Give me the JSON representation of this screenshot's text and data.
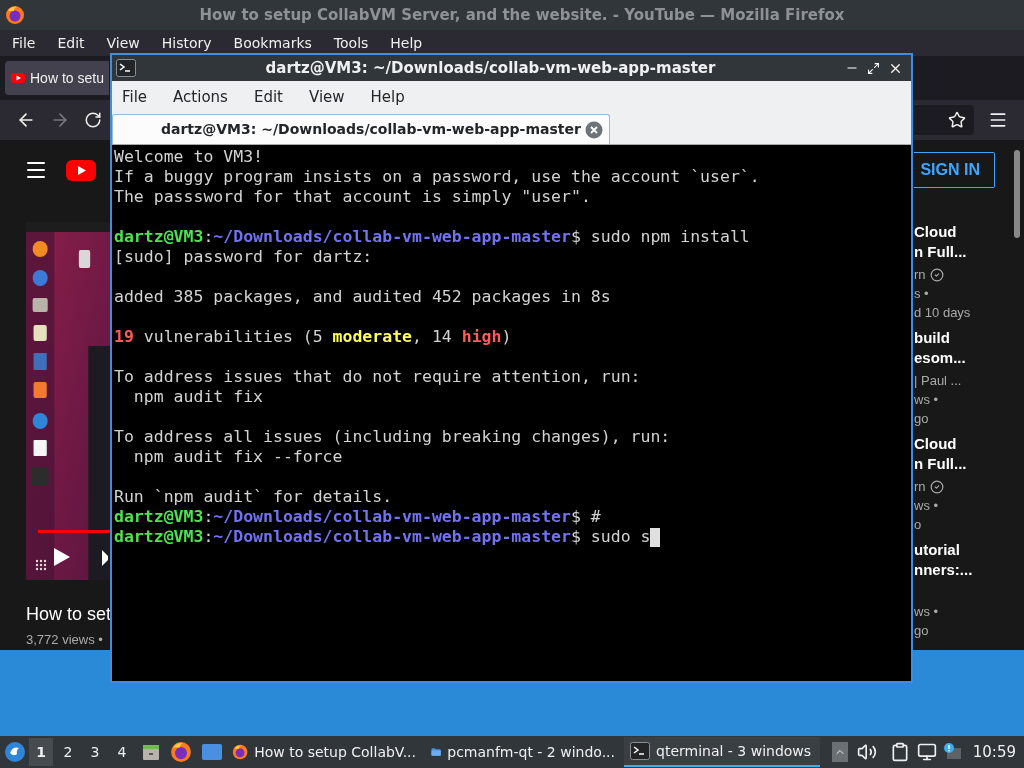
{
  "firefox": {
    "title": "How to setup CollabVM Server, and the website. - YouTube — Mozilla Firefox",
    "menu": [
      "File",
      "Edit",
      "View",
      "History",
      "Bookmarks",
      "Tools",
      "Help"
    ],
    "tabs": [
      {
        "label": "How to setu",
        "selected": true
      }
    ],
    "youtube": {
      "sign_in": "SIGN IN",
      "video": {
        "title": "How to set",
        "views": "3,772 views •",
        "progress": {
          "level": 1
        }
      },
      "recommendations": [
        {
          "title_lines": [
            "Cloud",
            "n Full..."
          ],
          "channel": "rn",
          "verified": true,
          "views": "s •",
          "age": "d 10 days"
        },
        {
          "title_lines": [
            "build",
            "esom..."
          ],
          "channel": "| Paul ...",
          "verified": false,
          "views": "ws •",
          "age": "go"
        },
        {
          "title_lines": [
            "Cloud",
            "n Full..."
          ],
          "channel": "rn",
          "verified": true,
          "views": "ws •",
          "age": "o"
        },
        {
          "title_lines": [
            "utorial",
            "nners:..."
          ],
          "verified": false,
          "views": "ws •",
          "age": "go"
        }
      ]
    }
  },
  "terminal": {
    "title": "dartz@VM3: ~/Downloads/collab-vm-web-app-master",
    "menu": [
      "File",
      "Actions",
      "Edit",
      "View",
      "Help"
    ],
    "tabs": [
      {
        "label": "dartz@VM3: ~/Downloads/collab-vm-web-app-master",
        "selected": true
      }
    ],
    "lines": [
      {
        "kind": "text",
        "cursor": false,
        "segments": [
          {
            "kind": "plain",
            "text": "Welcome to VM3!"
          }
        ]
      },
      {
        "kind": "text",
        "cursor": false,
        "segments": [
          {
            "kind": "plain",
            "text": "If a buggy program insists on a password, use the account `user`."
          }
        ]
      },
      {
        "kind": "text",
        "cursor": false,
        "segments": [
          {
            "kind": "plain",
            "text": "The passsword for that account is simply \"user\"."
          }
        ]
      },
      {
        "kind": "blank"
      },
      {
        "kind": "text",
        "cursor": false,
        "segments": [
          {
            "kind": "user",
            "text": "dartz@VM3"
          },
          {
            "kind": "plain",
            "text": ":"
          },
          {
            "kind": "path",
            "text": "~/Downloads/collab-vm-web-app-master"
          },
          {
            "kind": "plain",
            "text": "$ sudo npm install"
          }
        ]
      },
      {
        "kind": "text",
        "cursor": false,
        "segments": [
          {
            "kind": "plain",
            "text": "[sudo] password for dartz:"
          }
        ]
      },
      {
        "kind": "blank"
      },
      {
        "kind": "text",
        "cursor": false,
        "segments": [
          {
            "kind": "plain",
            "text": "added 385 packages, and audited 452 packages in 8s"
          }
        ]
      },
      {
        "kind": "blank"
      },
      {
        "kind": "text",
        "cursor": false,
        "segments": [
          {
            "kind": "red",
            "text": "19"
          },
          {
            "kind": "plain",
            "text": " vulnerabilities (5 "
          },
          {
            "kind": "yellow",
            "text": "moderate"
          },
          {
            "kind": "plain",
            "text": ", 14 "
          },
          {
            "kind": "red",
            "text": "high"
          },
          {
            "kind": "plain",
            "text": ")"
          }
        ]
      },
      {
        "kind": "blank"
      },
      {
        "kind": "text",
        "cursor": false,
        "segments": [
          {
            "kind": "plain",
            "text": "To address issues that do not require attention, run:"
          }
        ]
      },
      {
        "kind": "text",
        "cursor": false,
        "segments": [
          {
            "kind": "plain",
            "text": "  npm audit fix"
          }
        ]
      },
      {
        "kind": "blank"
      },
      {
        "kind": "text",
        "cursor": false,
        "segments": [
          {
            "kind": "plain",
            "text": "To address all issues (including breaking changes), run:"
          }
        ]
      },
      {
        "kind": "text",
        "cursor": false,
        "segments": [
          {
            "kind": "plain",
            "text": "  npm audit fix --force"
          }
        ]
      },
      {
        "kind": "blank"
      },
      {
        "kind": "text",
        "cursor": false,
        "segments": [
          {
            "kind": "plain",
            "text": "Run `npm audit` for details."
          }
        ]
      },
      {
        "kind": "text",
        "cursor": false,
        "segments": [
          {
            "kind": "user",
            "text": "dartz@VM3"
          },
          {
            "kind": "plain",
            "text": ":"
          },
          {
            "kind": "path",
            "text": "~/Downloads/collab-vm-web-app-master"
          },
          {
            "kind": "plain",
            "text": "$ #"
          }
        ]
      },
      {
        "kind": "text",
        "cursor": true,
        "segments": [
          {
            "kind": "user",
            "text": "dartz@VM3"
          },
          {
            "kind": "plain",
            "text": ":"
          },
          {
            "kind": "path",
            "text": "~/Downloads/collab-vm-web-app-master"
          },
          {
            "kind": "plain",
            "text": "$ sudo s"
          }
        ]
      }
    ]
  },
  "taskbar": {
    "workspaces": [
      {
        "label": "1",
        "selected": true
      },
      {
        "label": "2",
        "selected": false
      },
      {
        "label": "3",
        "selected": false
      },
      {
        "label": "4",
        "selected": false
      }
    ],
    "tasks": [
      {
        "kind": "firefox",
        "label": "How to setup CollabV...",
        "selected": false
      },
      {
        "kind": "folder",
        "label": "pcmanfm-qt - 2 windo...",
        "selected": false
      },
      {
        "kind": "terminal",
        "label": "qterminal - 3 windows",
        "selected": true
      }
    ],
    "clock": "10:59"
  }
}
